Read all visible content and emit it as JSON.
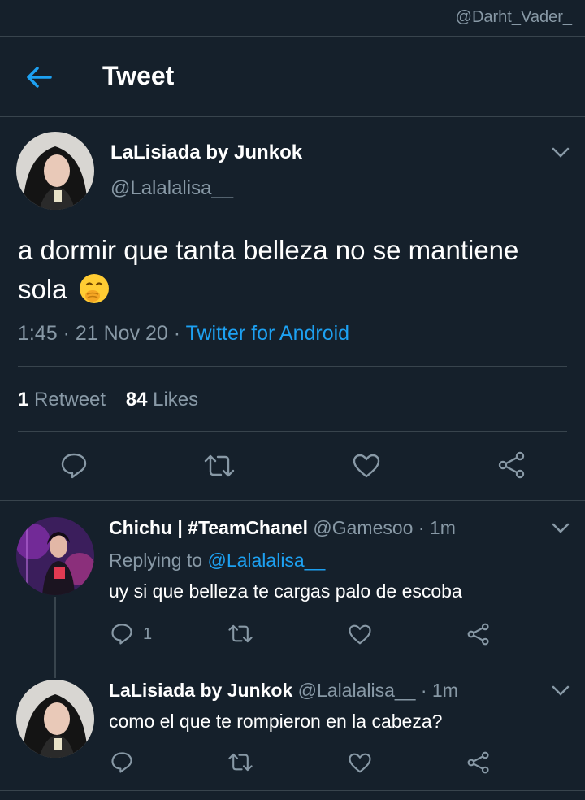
{
  "watermark": "@Darht_Vader_",
  "header": {
    "title": "Tweet",
    "back_icon": "arrow-left-icon"
  },
  "main_tweet": {
    "author_name": "LaLisiada by Junkok",
    "author_handle": "@Lalalalisa__",
    "text": "a dormir que tanta belleza no se mantiene sola",
    "emoji": "face-with-hand-over-mouth",
    "time": "1:45 · 21 Nov 20 · ",
    "source": "Twitter for Android",
    "retweet_count": "1",
    "retweet_label": " Retweet",
    "like_count": "84",
    "like_label": " Likes"
  },
  "replies": [
    {
      "author_name": "Chichu | #TeamChanel",
      "handle_meta": " @Gamesoo · 1m",
      "replying_label": "Replying to ",
      "replying_to": "@Lalalalisa__",
      "text": "uy si que belleza te cargas palo de escoba",
      "reply_count": "1"
    },
    {
      "author_name": "LaLisiada by Junkok",
      "handle_meta": " @Lalalalisa__ · 1m",
      "text": "como el que te rompieron en la cabeza?"
    }
  ],
  "colors": {
    "background": "#15202b",
    "accent": "#1da1f2",
    "secondary_text": "#8899a6",
    "divider": "#38444d"
  }
}
